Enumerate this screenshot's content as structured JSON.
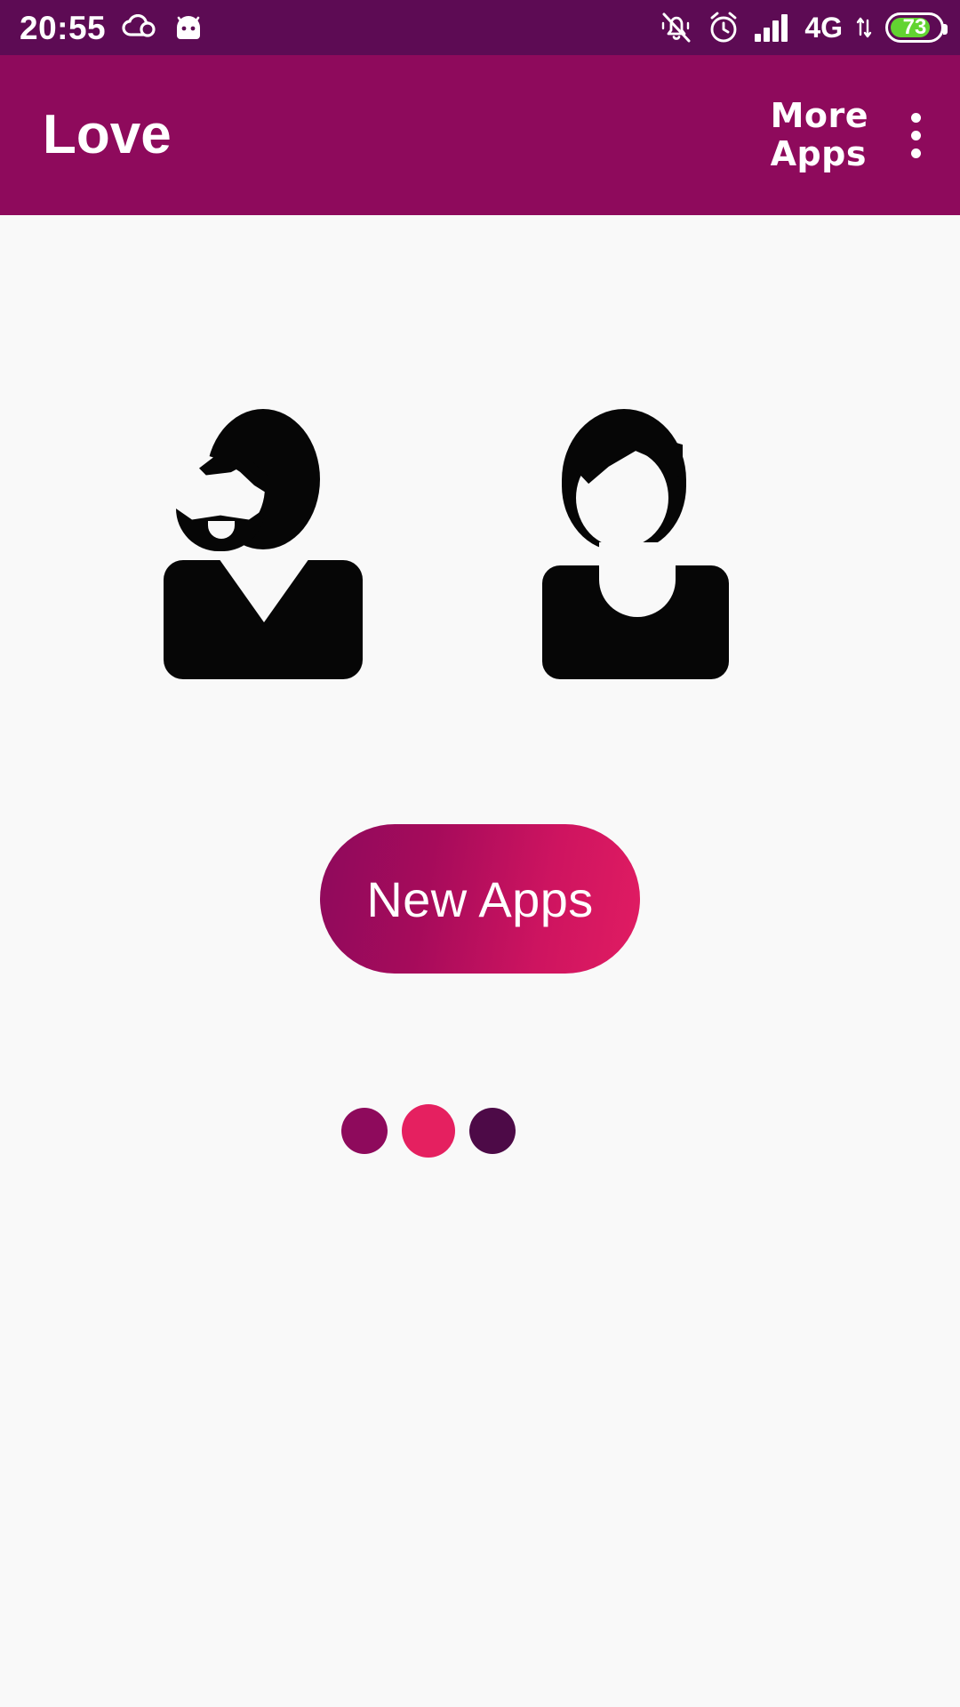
{
  "status_bar": {
    "time": "20:55",
    "icons_left": [
      "cloud-sync-icon",
      "android-head-icon"
    ],
    "icons_right": [
      "silent-bell-icon",
      "alarm-clock-icon",
      "signal-bars-icon",
      "data-arrows-icon"
    ],
    "network_label": "4G",
    "battery_level": "73",
    "battery_percent": 73,
    "background_color": "#5D0B54",
    "text_color": "#FFFFFF",
    "battery_fill_color": "#62D431"
  },
  "app_bar": {
    "title": "Love",
    "more_apps_line1": "More",
    "more_apps_line2": "Apps",
    "overflow_menu_icon": "overflow-menu-icon",
    "background_color": "#8E0A5C",
    "text_color": "#FFFFFF"
  },
  "main": {
    "background_color": "#F9F9F9",
    "illustration": {
      "name": "couple-illustration",
      "figures": [
        {
          "name": "man-figure",
          "description": "bearded man silhouette with v-neck shirt",
          "color": "#060606"
        },
        {
          "name": "woman-figure",
          "description": "short-haired woman silhouette with round neckline",
          "color": "#060606"
        }
      ]
    },
    "primary_button": {
      "label": "New Apps",
      "gradient_from": "#8E0A5C",
      "gradient_to": "#E11C62",
      "text_color": "#FFFFFF"
    },
    "page_dots": [
      {
        "name": "page-dot-1",
        "color": "#8E0A5C",
        "size": 52,
        "active": false
      },
      {
        "name": "page-dot-2",
        "color": "#E52060",
        "size": 60,
        "active": true
      },
      {
        "name": "page-dot-3",
        "color": "#4D0A47",
        "size": 52,
        "active": false
      }
    ]
  }
}
